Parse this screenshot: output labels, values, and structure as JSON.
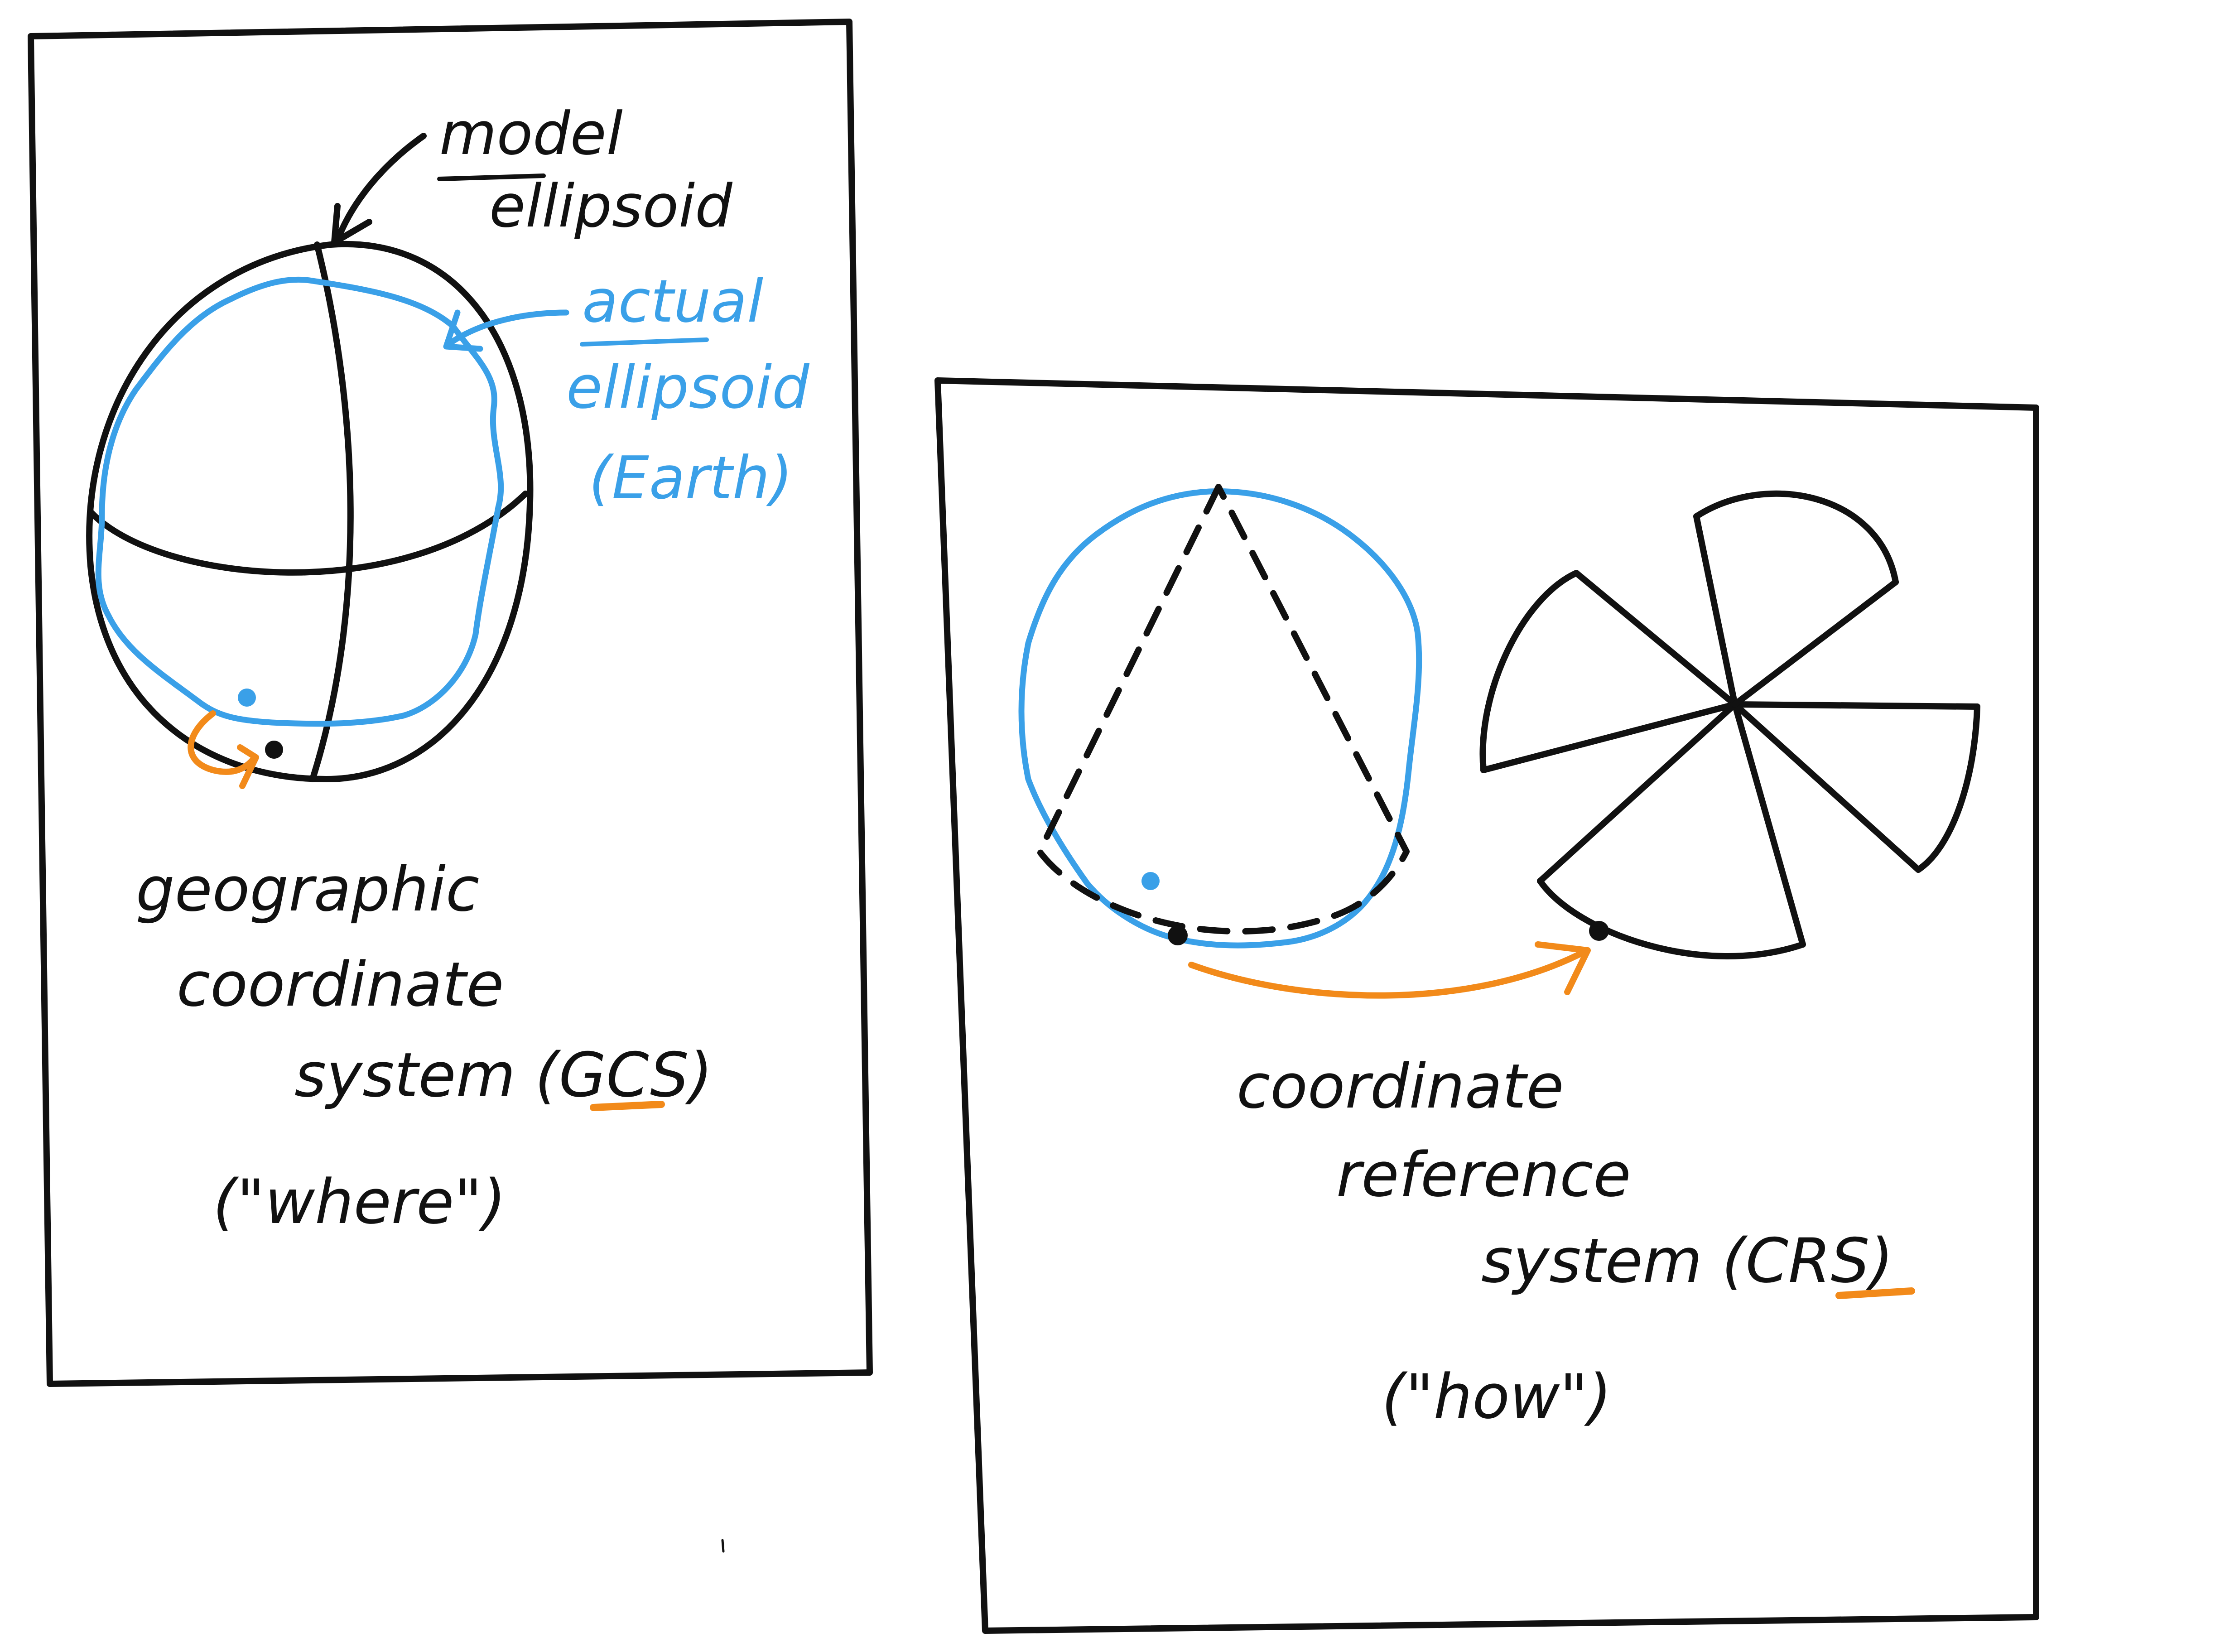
{
  "colors": {
    "ink": "#111111",
    "blue": "#3aa0e8",
    "orange": "#f28a1a",
    "background": "#ffffff"
  },
  "gcs_panel": {
    "model_label": [
      "model",
      "ellipsoid"
    ],
    "actual_label": [
      "actual",
      "ellipsoid",
      "(Earth)"
    ],
    "caption": [
      "geographic",
      "coordinate",
      "system (GCS)",
      "(\"where\")"
    ]
  },
  "crs_panel": {
    "caption": [
      "coordinate",
      "reference",
      "system (CRS)",
      "(\"how\")"
    ]
  }
}
